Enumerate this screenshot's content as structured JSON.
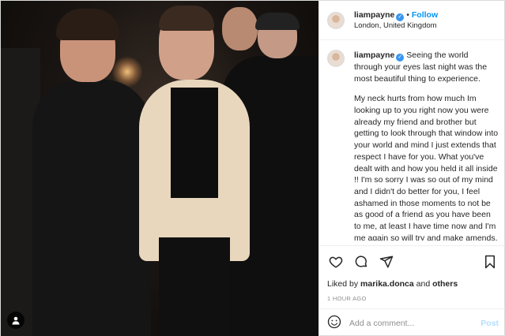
{
  "post": {
    "username": "liampayne",
    "follow_label": "Follow",
    "location": "London, United Kingdom",
    "caption_username": "liampayne",
    "caption_intro": "Seeing the world through your eyes last night was the most beautiful thing to experience.",
    "caption_body": "My neck hurts from how much Im looking up to you right now you were already my friend and brother but getting to look through that window into your world and mind I just extends that respect I have for you. What you've dealt with and how you held it all inside !! I'm so sorry I was so out of my mind and I didn't do better for you, I feel ashamed in those moments to not be as good of a friend as you have been to me, at least I have time now and I'm me again so will try and make amends.",
    "liked_by_prefix": "Liked by",
    "liked_by_user": "marika.donca",
    "liked_by_and": "and",
    "liked_by_others": "others",
    "timestamp": "1 HOUR AGO",
    "comment_placeholder": "Add a comment...",
    "post_label": "Post"
  },
  "colors": {
    "accent": "#0095f6",
    "verified": "#3897f0",
    "post_disabled": "#b2dffc",
    "muted": "#8e8e8e"
  },
  "icons": [
    "user-tag-icon",
    "verified-badge-icon",
    "heart-icon",
    "comment-icon",
    "share-icon",
    "bookmark-icon",
    "emoji-icon"
  ]
}
